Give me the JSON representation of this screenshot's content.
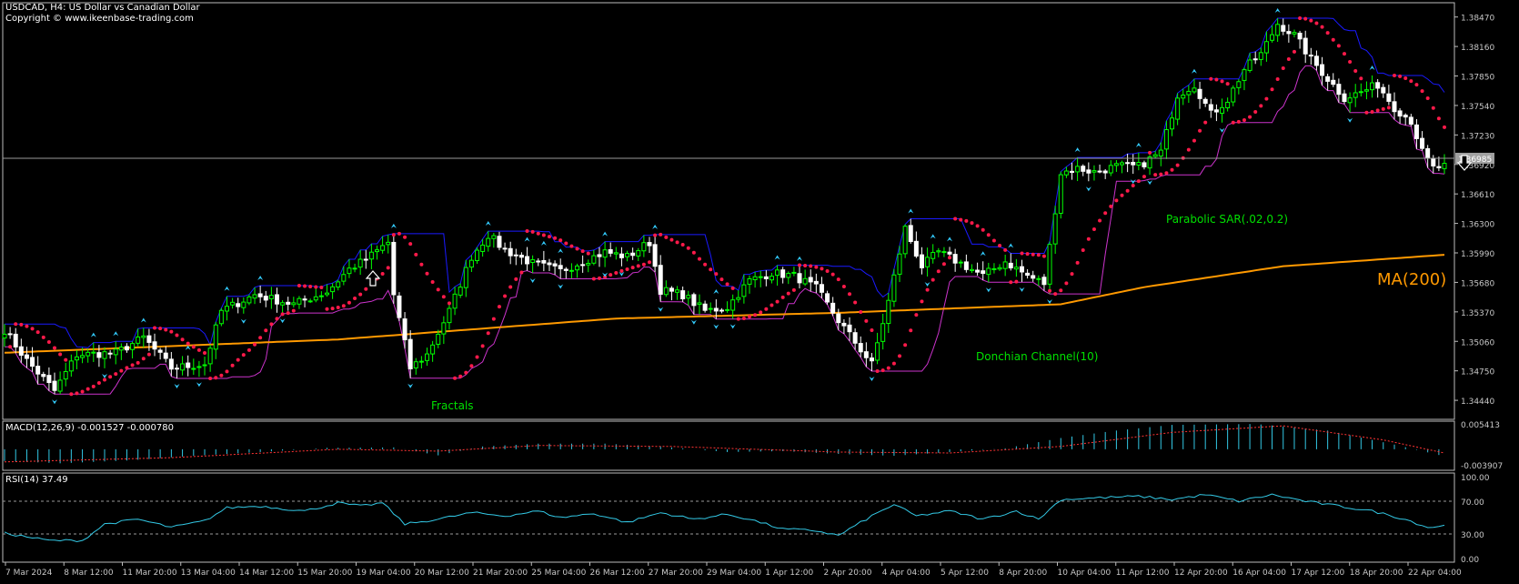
{
  "header": {
    "title": "USDCAD, H4:  US Dollar vs Canadian Dollar",
    "copyright": "Copyright © www.ikeenbase-trading.com"
  },
  "annotations": {
    "fractals": "Fractals",
    "parabolic_sar": "Parabolic SAR(.02,0.2)",
    "donchian": "Donchian Channel(10)",
    "ma": "MA(200)"
  },
  "colors": {
    "background": "#000000",
    "bull": "#00ff00",
    "bear": "#ffffff",
    "ma": "#ff9900",
    "sar": "#ff1a4a",
    "donchian_upper": "#1a1aff",
    "donchian_lower": "#cc33cc",
    "fractal": "#33ccff",
    "macd_hist": "#33c9e6",
    "macd_signal": "#ff3333",
    "rsi": "#33c9e6",
    "annotation_green": "#00e000",
    "annotation_orange": "#ff9900",
    "axis_text": "#c8c8c8",
    "current_price_tag": "#a0a0a0"
  },
  "chart_data": [
    {
      "type": "candlestick",
      "symbol": "USDCAD",
      "timeframe": "H4",
      "ylim": [
        1.3424,
        1.3862
      ],
      "yticks": [
        "1.38470",
        "1.38160",
        "1.37850",
        "1.37540",
        "1.37230",
        "1.36920",
        "1.36610",
        "1.36300",
        "1.35990",
        "1.35680",
        "1.35370",
        "1.35060",
        "1.34750",
        "1.34440"
      ],
      "current_price": "1.36985",
      "x_labels": [
        "7 Mar 2024",
        "8 Mar 12:00",
        "11 Mar 20:00",
        "13 Mar 04:00",
        "14 Mar 12:00",
        "15 Mar 20:00",
        "19 Mar 04:00",
        "20 Mar 12:00",
        "21 Mar 20:00",
        "25 Mar 04:00",
        "26 Mar 12:00",
        "27 Mar 20:00",
        "29 Mar 04:00",
        "1 Apr 12:00",
        "2 Apr 20:00",
        "4 Apr 04:00",
        "5 Apr 12:00",
        "8 Apr 20:00",
        "10 Apr 04:00",
        "11 Apr 12:00",
        "12 Apr 20:00",
        "16 Apr 04:00",
        "17 Apr 12:00",
        "18 Apr 20:00",
        "22 Apr 04:00"
      ],
      "close_anchors": [
        [
          0,
          1.3518
        ],
        [
          4,
          1.3486
        ],
        [
          9,
          1.3454
        ],
        [
          13,
          1.3492
        ],
        [
          20,
          1.3494
        ],
        [
          25,
          1.351
        ],
        [
          30,
          1.3478
        ],
        [
          36,
          1.3482
        ],
        [
          39,
          1.3538
        ],
        [
          45,
          1.3555
        ],
        [
          52,
          1.3545
        ],
        [
          58,
          1.3558
        ],
        [
          62,
          1.3582
        ],
        [
          65,
          1.3592
        ],
        [
          69,
          1.361
        ],
        [
          70,
          1.3555
        ],
        [
          73,
          1.3478
        ],
        [
          76,
          1.3492
        ],
        [
          80,
          1.3538
        ],
        [
          84,
          1.3595
        ],
        [
          87,
          1.3618
        ],
        [
          90,
          1.3602
        ],
        [
          95,
          1.3588
        ],
        [
          100,
          1.358
        ],
        [
          104,
          1.359
        ],
        [
          108,
          1.36
        ],
        [
          112,
          1.3595
        ],
        [
          116,
          1.361
        ],
        [
          118,
          1.356
        ],
        [
          122,
          1.3555
        ],
        [
          126,
          1.3538
        ],
        [
          130,
          1.3542
        ],
        [
          134,
          1.357
        ],
        [
          138,
          1.3578
        ],
        [
          142,
          1.3575
        ],
        [
          146,
          1.3562
        ],
        [
          150,
          1.3528
        ],
        [
          153,
          1.3505
        ],
        [
          156,
          1.3482
        ],
        [
          159,
          1.3548
        ],
        [
          162,
          1.3625
        ],
        [
          165,
          1.3585
        ],
        [
          168,
          1.36
        ],
        [
          172,
          1.3588
        ],
        [
          176,
          1.3575
        ],
        [
          180,
          1.359
        ],
        [
          184,
          1.3575
        ],
        [
          187,
          1.3567
        ],
        [
          190,
          1.3683
        ],
        [
          193,
          1.3688
        ],
        [
          196,
          1.3684
        ],
        [
          200,
          1.369
        ],
        [
          204,
          1.369
        ],
        [
          208,
          1.3705
        ],
        [
          211,
          1.3765
        ],
        [
          214,
          1.3776
        ],
        [
          217,
          1.3745
        ],
        [
          220,
          1.376
        ],
        [
          223,
          1.3792
        ],
        [
          226,
          1.3808
        ],
        [
          229,
          1.384
        ],
        [
          232,
          1.3828
        ],
        [
          235,
          1.3803
        ],
        [
          238,
          1.3782
        ],
        [
          241,
          1.3762
        ],
        [
          244,
          1.3768
        ],
        [
          247,
          1.3776
        ],
        [
          250,
          1.3752
        ],
        [
          253,
          1.3738
        ],
        [
          255,
          1.3705
        ],
        [
          257,
          1.3688
        ],
        [
          259,
          1.369
        ]
      ]
    },
    {
      "type": "line",
      "name": "MA(200)",
      "anchors": [
        [
          0,
          1.3494
        ],
        [
          60,
          1.3508
        ],
        [
          110,
          1.353
        ],
        [
          150,
          1.3536
        ],
        [
          190,
          1.3545
        ],
        [
          205,
          1.3563
        ],
        [
          230,
          1.3585
        ],
        [
          259,
          1.3597
        ]
      ]
    },
    {
      "type": "bar",
      "name": "MACD(12,26,9)",
      "readout": "MACD(12,26,9) -0.001527 -0.000780",
      "ylim": [
        -0.003907,
        0.005413
      ],
      "yticks": [
        "0.005413",
        "-0.003907"
      ],
      "hist_anchors": [
        [
          0,
          -0.0025
        ],
        [
          10,
          -0.003
        ],
        [
          22,
          -0.0024
        ],
        [
          34,
          -0.0014
        ],
        [
          46,
          -0.0006
        ],
        [
          58,
          0.0003
        ],
        [
          70,
          0.0004
        ],
        [
          78,
          -0.0013
        ],
        [
          86,
          0.0006
        ],
        [
          96,
          0.0012
        ],
        [
          108,
          0.0012
        ],
        [
          118,
          0.0006
        ],
        [
          130,
          -0.0006
        ],
        [
          140,
          -0.0004
        ],
        [
          150,
          -0.001
        ],
        [
          160,
          -0.0014
        ],
        [
          170,
          -0.0006
        ],
        [
          180,
          0.0002
        ],
        [
          190,
          0.0024
        ],
        [
          200,
          0.004
        ],
        [
          210,
          0.0052
        ],
        [
          225,
          0.0054
        ],
        [
          238,
          0.004
        ],
        [
          250,
          0.001
        ],
        [
          259,
          -0.0015
        ]
      ],
      "signal_anchors": [
        [
          0,
          -0.0027
        ],
        [
          30,
          -0.0018
        ],
        [
          60,
          0.0
        ],
        [
          78,
          -0.0004
        ],
        [
          96,
          0.0008
        ],
        [
          120,
          0.0006
        ],
        [
          150,
          -0.0006
        ],
        [
          170,
          -0.0008
        ],
        [
          190,
          0.0006
        ],
        [
          210,
          0.0036
        ],
        [
          230,
          0.005
        ],
        [
          248,
          0.002
        ],
        [
          259,
          -0.0008
        ]
      ]
    },
    {
      "type": "line",
      "name": "RSI(14)",
      "readout": "RSI(14) 37.49",
      "ylim": [
        0,
        100
      ],
      "yticks": [
        "100.00",
        "70.00",
        "30.00",
        "0.00"
      ],
      "levels": [
        70,
        30
      ],
      "anchors": [
        [
          0,
          31
        ],
        [
          8,
          22
        ],
        [
          14,
          22
        ],
        [
          18,
          42
        ],
        [
          24,
          48
        ],
        [
          30,
          38
        ],
        [
          36,
          46
        ],
        [
          40,
          62
        ],
        [
          46,
          64
        ],
        [
          54,
          58
        ],
        [
          60,
          68
        ],
        [
          64,
          64
        ],
        [
          68,
          68
        ],
        [
          72,
          42
        ],
        [
          78,
          48
        ],
        [
          84,
          56
        ],
        [
          90,
          52
        ],
        [
          96,
          58
        ],
        [
          100,
          50
        ],
        [
          106,
          55
        ],
        [
          112,
          44
        ],
        [
          118,
          56
        ],
        [
          124,
          48
        ],
        [
          130,
          54
        ],
        [
          134,
          48
        ],
        [
          140,
          36
        ],
        [
          146,
          34
        ],
        [
          150,
          28
        ],
        [
          156,
          52
        ],
        [
          160,
          66
        ],
        [
          164,
          52
        ],
        [
          170,
          58
        ],
        [
          176,
          48
        ],
        [
          182,
          58
        ],
        [
          186,
          48
        ],
        [
          190,
          72
        ],
        [
          196,
          74
        ],
        [
          204,
          76
        ],
        [
          210,
          72
        ],
        [
          216,
          78
        ],
        [
          222,
          70
        ],
        [
          228,
          78
        ],
        [
          234,
          70
        ],
        [
          240,
          64
        ],
        [
          246,
          58
        ],
        [
          252,
          48
        ],
        [
          256,
          38
        ],
        [
          259,
          40
        ]
      ]
    }
  ]
}
